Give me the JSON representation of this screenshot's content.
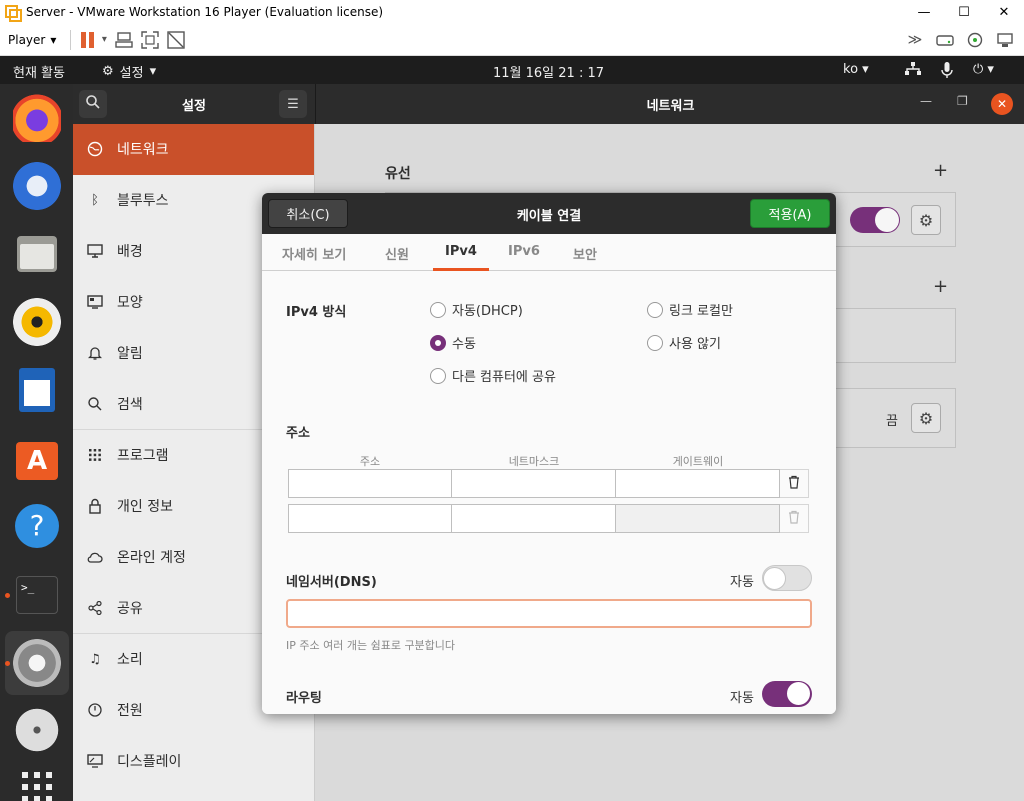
{
  "vm": {
    "title": "Server - VMware Workstation 16 Player (Evaluation license)",
    "player_menu": "Player",
    "win_min": "—",
    "win_max": "☐",
    "win_close": "✕"
  },
  "topbar": {
    "activities": "현재 활동",
    "app_menu": "설정",
    "clock": "11월 16일  21 : 17",
    "lang": "ko"
  },
  "settings": {
    "sidebar_title": "설정",
    "main_title": "네트워크",
    "sidebar_items": [
      {
        "label": "네트워크",
        "icon": "network-icon"
      },
      {
        "label": "블루투스",
        "icon": "bluetooth-icon"
      },
      {
        "label": "배경",
        "icon": "background-icon"
      },
      {
        "label": "모양",
        "icon": "appearance-icon"
      },
      {
        "label": "알림",
        "icon": "bell-icon"
      },
      {
        "label": "검색",
        "icon": "search-icon"
      },
      {
        "label": "프로그램",
        "icon": "apps-grid-icon"
      },
      {
        "label": "개인 정보",
        "icon": "lock-icon"
      },
      {
        "label": "온라인 계정",
        "icon": "cloud-icon"
      },
      {
        "label": "공유",
        "icon": "share-icon"
      },
      {
        "label": "소리",
        "icon": "music-note-icon"
      },
      {
        "label": "전원",
        "icon": "power-icon"
      },
      {
        "label": "디스플레이",
        "icon": "display-icon"
      }
    ],
    "network": {
      "wired_label": "유선",
      "off_label": "끔"
    }
  },
  "dialog": {
    "title": "케이블 연결",
    "cancel": "취소(C)",
    "apply": "적용(A)",
    "tabs": [
      "자세히 보기",
      "신원",
      "IPv4",
      "IPv6",
      "보안"
    ],
    "active_tab": "IPv4",
    "ipv4_method_label": "IPv4 방식",
    "methods": [
      {
        "label": "자동(DHCP)",
        "checked": false
      },
      {
        "label": "링크 로컬만",
        "checked": false
      },
      {
        "label": "수동",
        "checked": true
      },
      {
        "label": "사용 않기",
        "checked": false
      },
      {
        "label": "다른 컴퓨터에 공유",
        "checked": false
      }
    ],
    "address_label": "주소",
    "columns": [
      "주소",
      "네트마스크",
      "게이트웨이"
    ],
    "dns_label": "네임서버(DNS)",
    "dns_auto_label": "자동",
    "dns_auto": false,
    "dns_value": "",
    "dns_hint": "IP 주소 여러 개는 쉼표로 구분합니다",
    "routing_label": "라우팅",
    "routing_auto_label": "자동",
    "routing_auto": true
  },
  "colors": {
    "accent": "#e95420",
    "toggle_on": "#77307a",
    "apply_green": "#2a9e3a"
  }
}
